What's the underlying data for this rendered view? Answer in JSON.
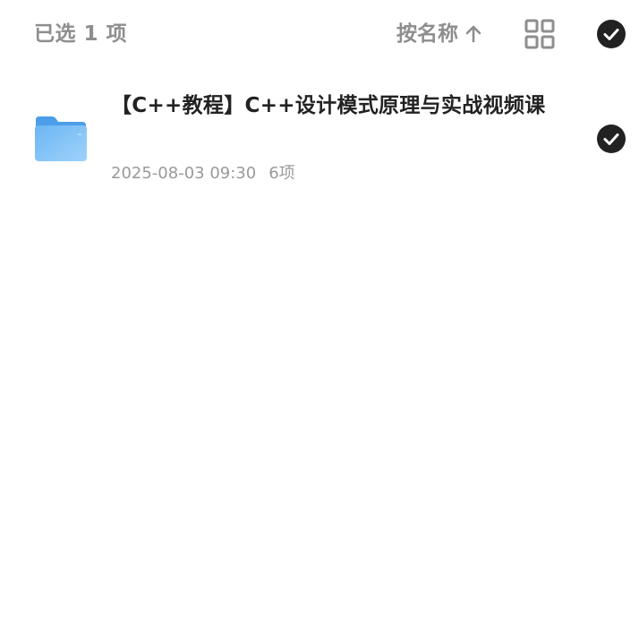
{
  "header": {
    "selected_label": "已选 1 项",
    "sort_label": "按名称",
    "sort_icon": "arrow-up-icon",
    "view_icon": "grid-view-icon",
    "select_all_icon": "check-circle-icon"
  },
  "files": [
    {
      "name": "【C++教程】C++设计模式原理与实战视频课",
      "date": "2025-08-03 09:30",
      "count": "6项",
      "icon": "folder-icon",
      "selected": true
    }
  ],
  "colors": {
    "header_text": "#8e8e8e",
    "name_text": "#222222",
    "meta_text": "#9a9a9a",
    "check_fill": "#222222",
    "folder_blue": "#5aaaf0"
  }
}
